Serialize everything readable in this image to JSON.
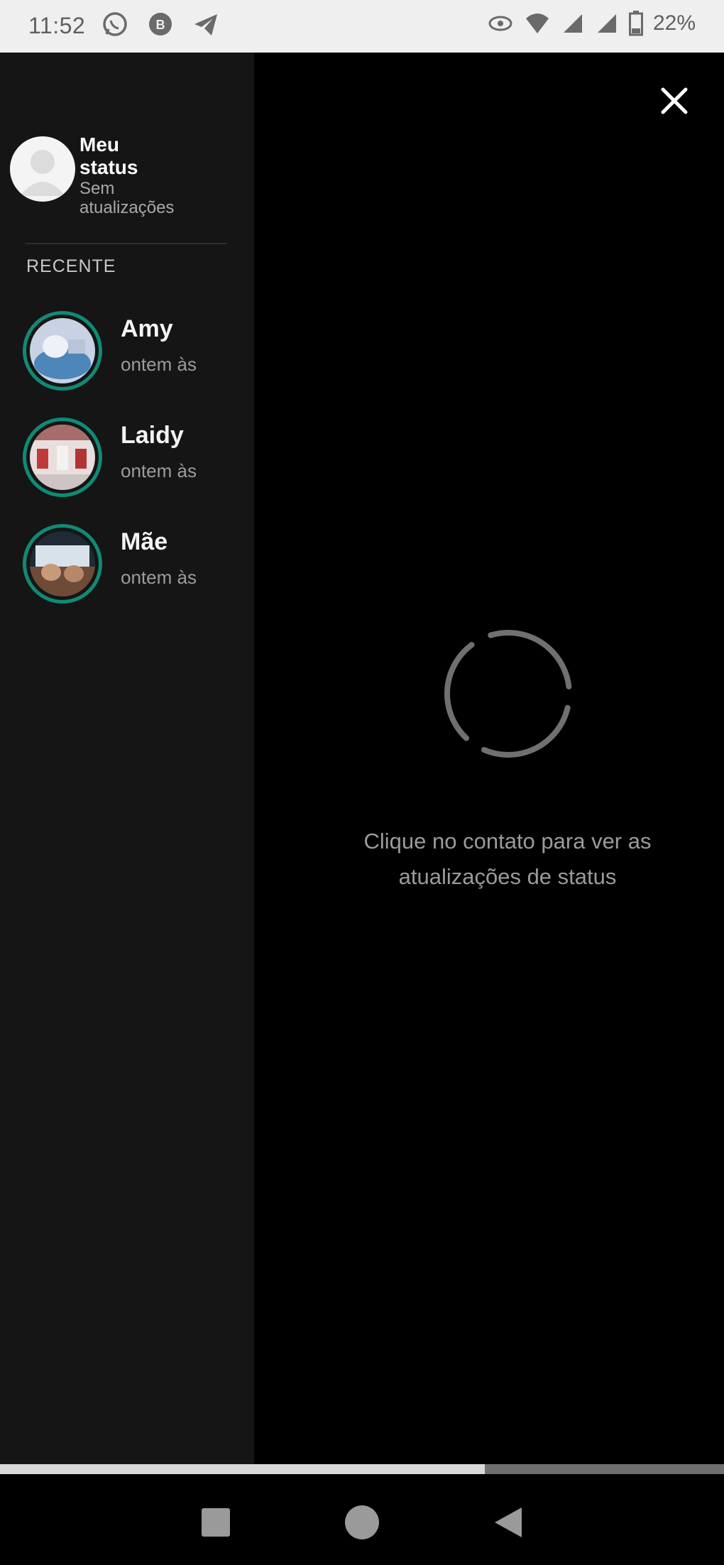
{
  "status_bar": {
    "time": "11:52",
    "battery": "22%",
    "icons": [
      "whatsapp-icon",
      "whatsapp-business-icon",
      "telegram-icon",
      "eye-icon",
      "wifi-icon",
      "signal-icon",
      "battery-icon"
    ]
  },
  "sidebar": {
    "my_status": {
      "title": "Meu status",
      "subtitle": "Sem atualizações"
    },
    "section_label": "RECENTE",
    "contacts": [
      {
        "name": "Amy",
        "time": "ontem às"
      },
      {
        "name": "Laidy",
        "time": "ontem às"
      },
      {
        "name": "Mãe",
        "time": "ontem às"
      }
    ]
  },
  "main": {
    "hint": "Clique no contato para ver as atualizações de status"
  },
  "progress": {
    "fraction": 0.67
  },
  "colors": {
    "ring": "#108a75",
    "sidebar_bg": "#151515",
    "main_bg": "#000000",
    "statusbar_bg": "#efefef"
  }
}
